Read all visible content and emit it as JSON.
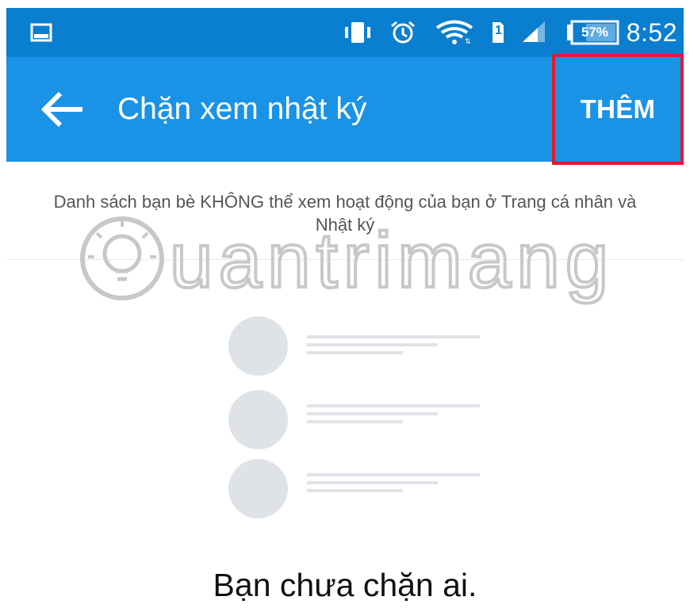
{
  "status_bar": {
    "time": "8:52",
    "battery": "57%",
    "sim": "1",
    "icons": [
      "gallery-icon",
      "vibrate-icon",
      "alarm-icon",
      "wifi-icon",
      "sim-card-icon",
      "signal-icon",
      "battery-icon"
    ]
  },
  "app_bar": {
    "back_icon": "arrow-left-icon",
    "title": "Chặn xem nhật ký",
    "add_label": "THÊM"
  },
  "content": {
    "description": "Danh sách bạn bè KHÔNG thể xem hoạt động của bạn ở Trang cá nhân và Nhật ký",
    "watermark": "Quantrimang",
    "empty_message": "Bạn chưa chặn ai."
  },
  "colors": {
    "status_bar": "#0a7fcf",
    "app_bar": "#1a93e6",
    "highlight_border": "#e21b2b",
    "placeholder": "#dfe3e8",
    "watermark": "#c8c8c8"
  }
}
